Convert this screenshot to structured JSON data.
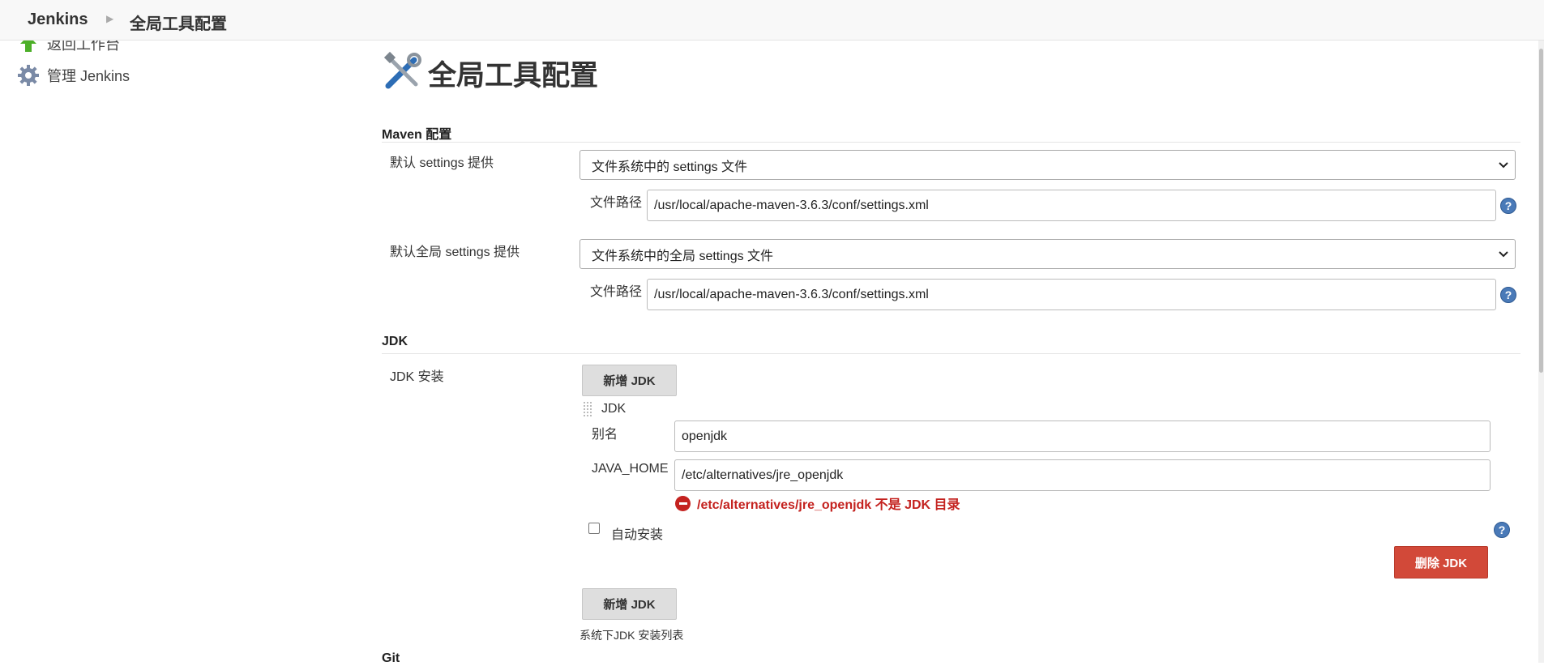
{
  "breadcrumb": {
    "home": "Jenkins",
    "current": "全局工具配置"
  },
  "sidebar": {
    "items": [
      {
        "label": "返回工作台",
        "icon": "up-arrow-icon"
      },
      {
        "label": "管理 Jenkins",
        "icon": "gear-icon"
      }
    ]
  },
  "page": {
    "title": "全局工具配置",
    "title_icon": "tools-icon"
  },
  "maven": {
    "section_title": "Maven 配置",
    "settings": {
      "label": "默认 settings 提供",
      "selected": "文件系统中的 settings 文件",
      "path_label": "文件路径",
      "path_value": "/usr/local/apache-maven-3.6.3/conf/settings.xml"
    },
    "global_settings": {
      "label": "默认全局 settings 提供",
      "selected": "文件系统中的全局 settings 文件",
      "path_label": "文件路径",
      "path_value": "/usr/local/apache-maven-3.6.3/conf/settings.xml"
    }
  },
  "jdk": {
    "section_title": "JDK",
    "install_label": "JDK 安装",
    "add_button": "新增 JDK",
    "entry_title": "JDK",
    "alias_label": "别名",
    "alias_value": "openjdk",
    "java_home_label": "JAVA_HOME",
    "java_home_value": "/etc/alternatives/jre_openjdk",
    "error_text": "/etc/alternatives/jre_openjdk 不是 JDK 目录",
    "auto_install_label": "自动安装",
    "auto_install_checked": false,
    "delete_button": "删除 JDK",
    "add_button_bottom": "新增 JDK",
    "list_caption": "系统下JDK 安装列表"
  },
  "git": {
    "section_title": "Git"
  },
  "colors": {
    "error": "#c4221f",
    "danger_button": "#d24939",
    "help_icon": "#4a7ab8"
  }
}
